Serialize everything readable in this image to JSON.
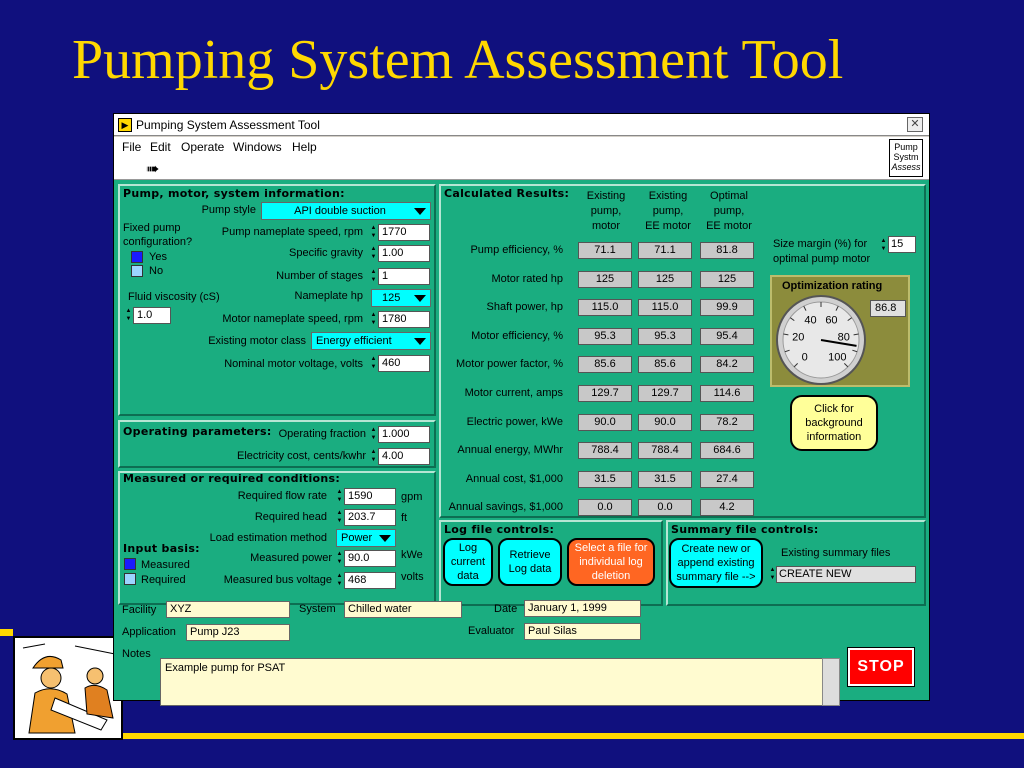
{
  "slide": {
    "title": "Pumping System Assessment Tool"
  },
  "window": {
    "title": "Pumping System Assessment Tool",
    "close": "✕",
    "vi_icon": [
      "Pump",
      "Systm",
      "Assess"
    ]
  },
  "menu": [
    "File",
    "Edit",
    "Operate",
    "Windows",
    "Help"
  ],
  "pump_section": {
    "title": "Pump, motor, system information:",
    "pump_style_label": "Pump style",
    "pump_style": "API double suction",
    "fixed_config_label": "Fixed pump configuration?",
    "yes": "Yes",
    "no": "No",
    "fluid_viscosity_label": "Fluid viscosity (cS)",
    "fluid_viscosity": "1.0",
    "fields": [
      {
        "label": "Pump nameplate speed, rpm",
        "value": "1770"
      },
      {
        "label": "Specific gravity",
        "value": "1.00"
      },
      {
        "label": "Number of stages",
        "value": "1"
      },
      {
        "label": "Nameplate hp",
        "value": "125"
      },
      {
        "label": "Motor nameplate speed, rpm",
        "value": "1780"
      },
      {
        "label": "Existing motor class",
        "value": "Energy efficient"
      },
      {
        "label": "Nominal motor voltage, volts",
        "value": "460"
      }
    ]
  },
  "operating": {
    "title": "Operating parameters:",
    "operating_fraction_label": "Operating fraction",
    "operating_fraction": "1.000",
    "electricity_cost_label": "Electricity cost, cents/kwhr",
    "electricity_cost": "4.00"
  },
  "measured": {
    "title": "Measured or required conditions:",
    "input_basis_label": "Input basis:",
    "measured_radio": "Measured",
    "required_radio": "Required",
    "rows": [
      {
        "label": "Required flow rate",
        "value": "1590",
        "unit": "gpm"
      },
      {
        "label": "Required head",
        "value": "203.7",
        "unit": "ft"
      },
      {
        "label": "Load estimation method",
        "value": "Power",
        "unit": ""
      },
      {
        "label": "Measured power",
        "value": "90.0",
        "unit": "kWe"
      },
      {
        "label": "Measured bus voltage",
        "value": "468",
        "unit": "volts"
      }
    ]
  },
  "results": {
    "title": "Calculated Results:",
    "columns": [
      "Existing pump, motor",
      "Existing pump, EE motor",
      "Optimal pump, EE motor"
    ],
    "rows": [
      {
        "label": "Pump efficiency, %",
        "values": [
          "71.1",
          "71.1",
          "81.8"
        ]
      },
      {
        "label": "Motor rated hp",
        "values": [
          "125",
          "125",
          "125"
        ]
      },
      {
        "label": "Shaft power, hp",
        "values": [
          "115.0",
          "115.0",
          "99.9"
        ]
      },
      {
        "label": "Motor efficiency, %",
        "values": [
          "95.3",
          "95.3",
          "95.4"
        ]
      },
      {
        "label": "Motor power factor, %",
        "values": [
          "85.6",
          "85.6",
          "84.2"
        ]
      },
      {
        "label": "Motor current, amps",
        "values": [
          "129.7",
          "129.7",
          "114.6"
        ]
      },
      {
        "label": "Electric power, kWe",
        "values": [
          "90.0",
          "90.0",
          "78.2"
        ]
      },
      {
        "label": "Annual energy, MWhr",
        "values": [
          "788.4",
          "788.4",
          "684.6"
        ]
      },
      {
        "label": "Annual cost, $1,000",
        "values": [
          "31.5",
          "31.5",
          "27.4"
        ]
      },
      {
        "label": "Annual savings, $1,000",
        "values": [
          "0.0",
          "0.0",
          "4.2"
        ]
      }
    ],
    "size_margin_label": "Size margin (%) for optimal pump motor",
    "size_margin": "15",
    "optimization_title": "Optimization rating",
    "optimization_value": "86.8",
    "gauge_ticks": [
      "0",
      "20",
      "40",
      "60",
      "80",
      "100"
    ],
    "gauge_value": 86.8,
    "background_button": "Click for background information"
  },
  "log": {
    "title": "Log file controls:",
    "log_current": "Log current data",
    "retrieve_log": "Retrieve Log data",
    "select_file": "Select a file for individual log deletion"
  },
  "summary": {
    "title": "Summary file controls:",
    "create_button": "Create new or append existing summary file -->",
    "existing_label": "Existing summary files",
    "existing_value": "CREATE NEW"
  },
  "footer": {
    "facility_label": "Facility",
    "facility": "XYZ",
    "system_label": "System",
    "system": "Chilled water",
    "date_label": "Date",
    "date": "January 1, 1999",
    "application_label": "Application",
    "application": "Pump J23",
    "evaluator_label": "Evaluator",
    "evaluator": "Paul Silas",
    "notes_label": "Notes",
    "notes": "Example pump for PSAT",
    "stop": "STOP"
  }
}
